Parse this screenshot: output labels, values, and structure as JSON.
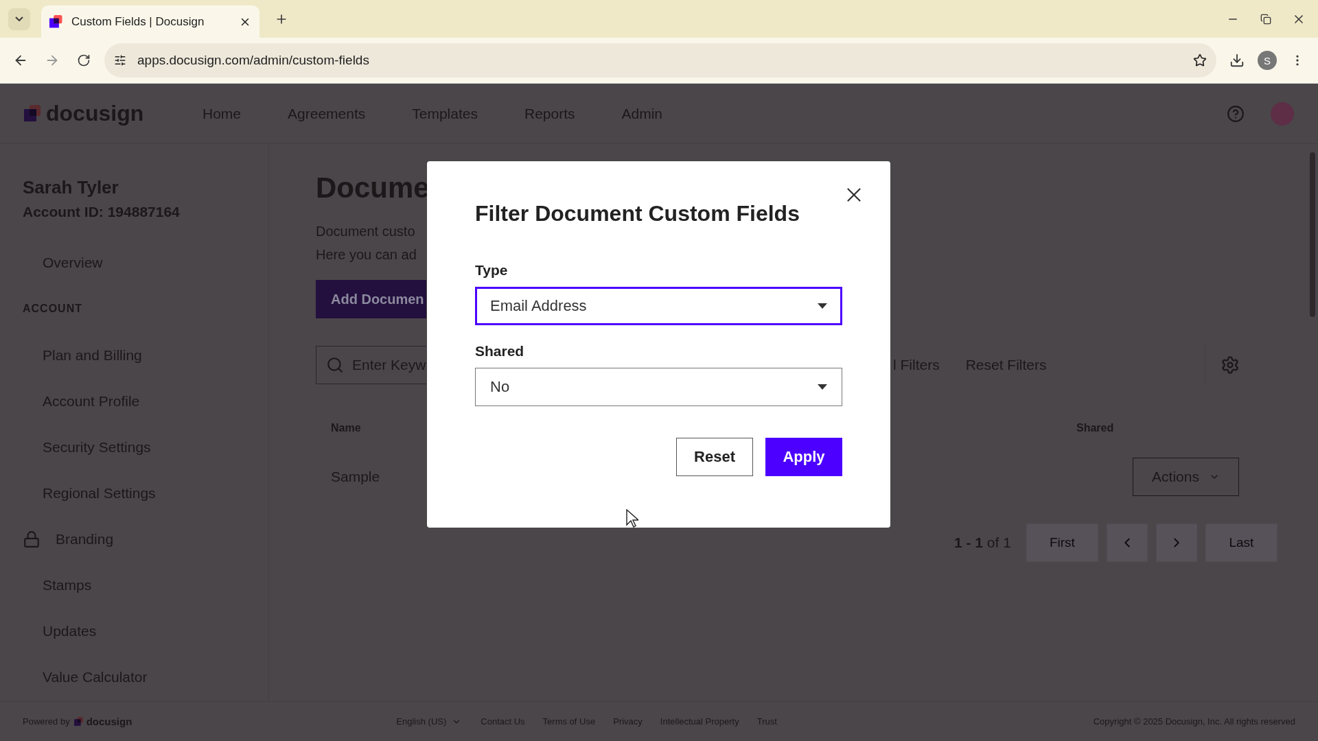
{
  "browser": {
    "tab_title": "Custom Fields | Docusign",
    "url": "apps.docusign.com/admin/custom-fields",
    "profile_initial": "S"
  },
  "header": {
    "logo": "docusign",
    "nav": [
      "Home",
      "Agreements",
      "Templates",
      "Reports",
      "Admin"
    ]
  },
  "sidebar": {
    "user_name": "Sarah Tyler",
    "account_id": "Account ID: 194887164",
    "items": [
      {
        "label": "Overview",
        "kind": "link"
      },
      {
        "label": "ACCOUNT",
        "kind": "heading"
      },
      {
        "label": "Plan and Billing",
        "kind": "link"
      },
      {
        "label": "Account Profile",
        "kind": "link"
      },
      {
        "label": "Security Settings",
        "kind": "link"
      },
      {
        "label": "Regional Settings",
        "kind": "link"
      },
      {
        "label": "Branding",
        "kind": "locked"
      },
      {
        "label": "Stamps",
        "kind": "link"
      },
      {
        "label": "Updates",
        "kind": "link"
      },
      {
        "label": "Value Calculator",
        "kind": "link"
      }
    ]
  },
  "main": {
    "title": "Docume",
    "description": [
      "Document custo",
      "Here you can ad"
    ],
    "add_button": "Add Documen",
    "search_placeholder": "Enter Keyw",
    "filter_links": [
      "l Filters",
      "Reset Filters"
    ],
    "columns": [
      "Name",
      "Shared"
    ],
    "rows": [
      {
        "name": "Sample",
        "action": "Actions"
      }
    ],
    "pagination": {
      "range": "**1 - 1** of 1",
      "buttons": [
        {
          "kind": "text",
          "label": "First",
          "disabled": true
        },
        {
          "kind": "prev",
          "disabled": true
        },
        {
          "kind": "next",
          "disabled": true
        },
        {
          "kind": "text",
          "label": "Last",
          "disabled": true
        }
      ]
    }
  },
  "footer": {
    "powered_by": "Powered by",
    "logo": "docusign",
    "language": "English (US)",
    "links": [
      "Contact Us",
      "Terms of Use",
      "Privacy",
      "Intellectual Property",
      "Trust"
    ],
    "copyright": "Copyright © 2025 Docusign, Inc. All rights reserved"
  },
  "dialog": {
    "title": "Filter Document Custom Fields",
    "fields": [
      {
        "label": "Type",
        "value": "Email Address",
        "focused": true
      },
      {
        "label": "Shared",
        "value": "No",
        "focused": false
      }
    ],
    "buttons": [
      {
        "label": "Reset",
        "kind": "secondary"
      },
      {
        "label": "Apply",
        "kind": "primary"
      }
    ]
  }
}
